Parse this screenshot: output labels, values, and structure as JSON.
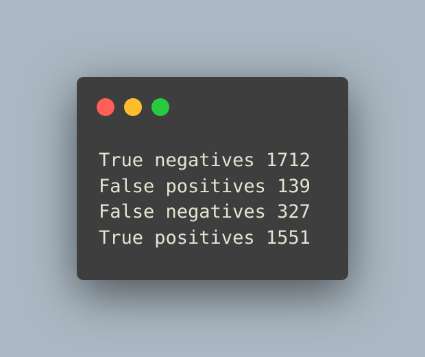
{
  "window": {
    "controls": [
      {
        "name": "close",
        "color": "#ff5f56"
      },
      {
        "name": "minimize",
        "color": "#ffbd2e"
      },
      {
        "name": "zoom",
        "color": "#27c93f"
      }
    ]
  },
  "code": {
    "lines": [
      "True negatives 1712",
      "False positives 139",
      "False negatives 327",
      "True positives 1551"
    ]
  },
  "colors": {
    "background": "#abb8c3",
    "window": "#3e3e3e",
    "text": "#e6e3d3"
  }
}
